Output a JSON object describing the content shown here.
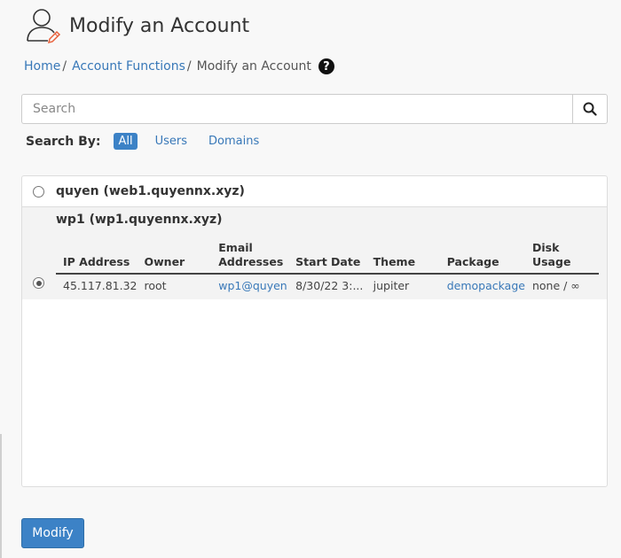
{
  "page": {
    "title": "Modify an Account"
  },
  "breadcrumb": {
    "home": "Home",
    "account_functions": "Account Functions",
    "current": "Modify an Account",
    "separator": "/"
  },
  "search": {
    "placeholder": "Search",
    "search_by_label": "Search By:",
    "filters": [
      "All",
      "Users",
      "Domains"
    ],
    "active_filter": "All"
  },
  "accounts": [
    {
      "label": "quyen (web1.quyennx.xyz)",
      "selected": false
    },
    {
      "label": "wp1 (wp1.quyennx.xyz)",
      "selected": true
    }
  ],
  "details": {
    "headers": {
      "ip": "IP Address",
      "owner": "Owner",
      "email_line1": "Email",
      "email_line2": "Addresses",
      "start": "Start Date",
      "theme": "Theme",
      "package": "Package",
      "disk": "Disk Usage"
    },
    "row": {
      "ip": "45.117.81.32",
      "owner": "root",
      "email": "wp1@quyennx",
      "start": "8/30/22 3:...",
      "theme": "jupiter",
      "package": "demopackage",
      "disk": "none / ∞"
    }
  },
  "actions": {
    "modify": "Modify"
  },
  "colors": {
    "link": "#3878b8",
    "primary_button": "#3c82c6",
    "icon_accent": "#e8613c"
  }
}
